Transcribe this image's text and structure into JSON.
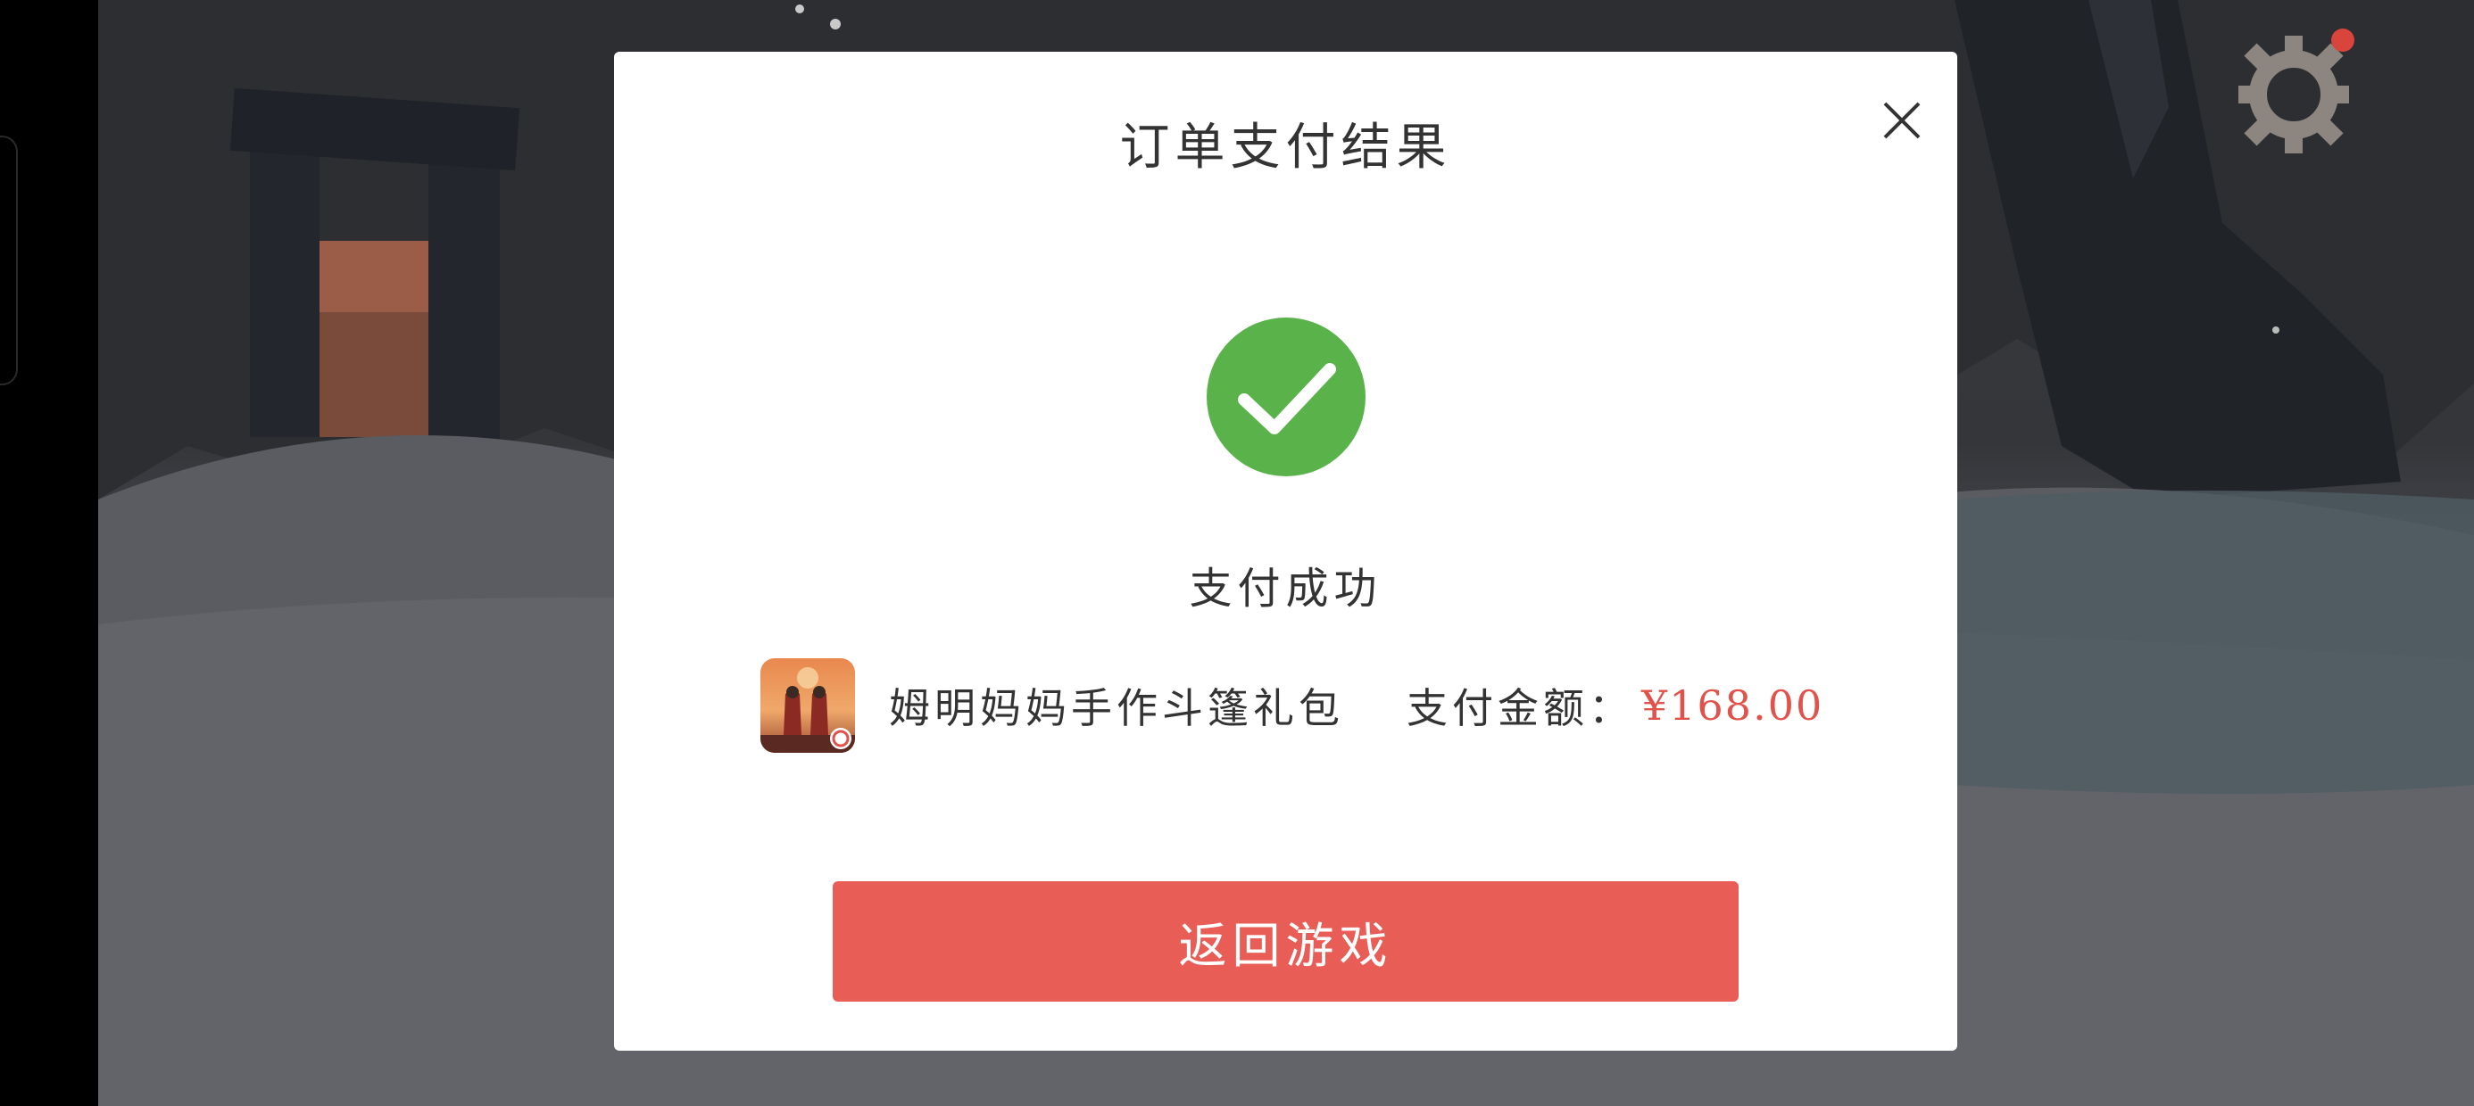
{
  "dialog": {
    "title": "订单支付结果",
    "status_text": "支付成功",
    "product": {
      "name": "姆明妈妈手作斗篷礼包",
      "amount_label": "支付金额：",
      "amount_value": "¥168.00"
    },
    "return_button_label": "返回游戏"
  },
  "icons": {
    "close": "close-icon",
    "success": "checkmark-icon",
    "settings": "gear-icon",
    "product": "game-app-icon"
  },
  "colors": {
    "success_green": "#5ab34a",
    "price_red": "#e0524a",
    "button_red": "#e85d56",
    "notification_dot": "#d9443c"
  }
}
